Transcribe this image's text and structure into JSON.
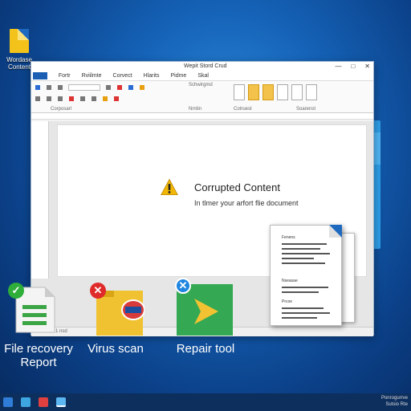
{
  "desktop": {
    "icon_label": "Wordase Content"
  },
  "window": {
    "title": "Wepit Stord Crud",
    "controls": [
      "—",
      "□",
      "✕"
    ],
    "menu": [
      "Fortr",
      "Rviilmte",
      "Corvect",
      "Hlarits",
      "Pidme",
      "Skal"
    ],
    "file_tab": "",
    "ribbon_labels": [
      "Corposarl",
      "Schwirgmd",
      "Nrntin",
      "Cotruest",
      "Soarenst"
    ],
    "document": {
      "heading": "Corrupted Content",
      "subtext": "In tlmer your arfort flie document"
    },
    "status": "1 nsd"
  },
  "tools": [
    {
      "label_line1": "File recovery",
      "label_line2": "Report",
      "badge": "✓",
      "badge_color": "#2fae3a",
      "icon": "document-icon"
    },
    {
      "label_line1": "Virus scan",
      "label_line2": "",
      "badge": "✕",
      "badge_color": "#e02a2a",
      "icon": "shield-folder-icon"
    },
    {
      "label_line1": "Repair tool",
      "label_line2": "",
      "badge": "✕",
      "badge_color": "#1f86e0",
      "icon": "repair-arrow-icon"
    }
  ],
  "report_doc": {
    "heading_1": "Fenens",
    "heading_2": "Nseasae",
    "heading_3": "Prcoe"
  },
  "taskbar": {
    "clock_line1": "Ponrogurrve",
    "clock_line2": "Sutsio Rte"
  },
  "colors": {
    "accent": "#1a5fb4",
    "warning": "#f2b705",
    "desktop": "#1563b8"
  }
}
